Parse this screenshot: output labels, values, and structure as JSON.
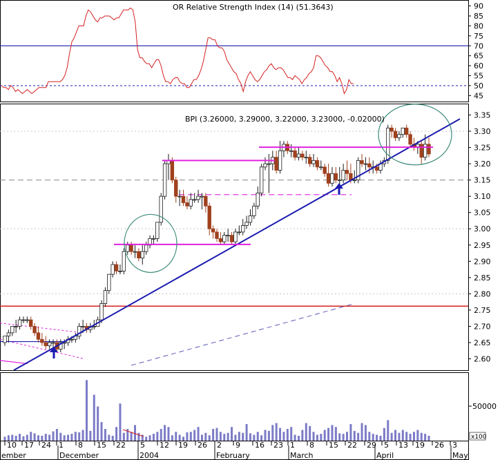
{
  "rsi": {
    "title": "OR Relative Strength Index (14) (51.3643)",
    "ticks": [
      90,
      85,
      80,
      75,
      70,
      65,
      60,
      55,
      50,
      45
    ],
    "ylim": [
      42,
      93
    ],
    "upper_level": 70,
    "lower_level": 50
  },
  "price": {
    "title": "BPI (3.26000, 3.29000, 3.22000, 3.23000, -0.02000)",
    "ticks": [
      "3.35",
      "3.30",
      "3.25",
      "3.20",
      "3.15",
      "3.10",
      "3.05",
      "3.00",
      "2.95",
      "2.90",
      "2.85",
      "2.80",
      "2.75",
      "2.70",
      "2.65",
      "2.60"
    ],
    "ylim": [
      2.565,
      3.385
    ]
  },
  "volume": {
    "tick_label": "50000",
    "scale_label": "x100"
  },
  "x_axis": {
    "day_labels": [
      "10",
      "17",
      "24",
      "1",
      "8",
      "15",
      "22",
      "5",
      "12",
      "19",
      "26",
      "2",
      "9",
      "16",
      "23",
      "1",
      "8",
      "15",
      "22",
      "29",
      "5",
      "13",
      "19",
      "26",
      "3"
    ],
    "month_labels": [
      "ember",
      "December",
      "2004",
      "February",
      "March",
      "April",
      "May"
    ]
  },
  "colors": {
    "background": "#ffffff",
    "grid": "#b0b0b0",
    "up_candle": "#ffffff",
    "down_candle": "#a0411e",
    "rsi_line": "#d42020",
    "trendline": "#1a1ab0",
    "resistance": "#e020e0",
    "support_red": "#d42020",
    "volume": "#7b7bc7",
    "circle": "#3d8a7a"
  },
  "chart_data": {
    "type": "candlestick",
    "dates": [
      "2003-11-06",
      "2003-11-07",
      "2003-11-10",
      "2003-11-11",
      "2003-11-12",
      "2003-11-13",
      "2003-11-14",
      "2003-11-17",
      "2003-11-18",
      "2003-11-19",
      "2003-11-20",
      "2003-11-21",
      "2003-11-24",
      "2003-11-25",
      "2003-11-26",
      "2003-11-27",
      "2003-11-28",
      "2003-12-01",
      "2003-12-02",
      "2003-12-03",
      "2003-12-04",
      "2003-12-05",
      "2003-12-08",
      "2003-12-09",
      "2003-12-10",
      "2003-12-11",
      "2003-12-12",
      "2003-12-15",
      "2003-12-16",
      "2003-12-17",
      "2003-12-18",
      "2003-12-19",
      "2003-12-22",
      "2003-12-23",
      "2003-12-26",
      "2003-12-29",
      "2003-12-30",
      "2004-01-02",
      "2004-01-05",
      "2004-01-06",
      "2004-01-07",
      "2004-01-08",
      "2004-01-09",
      "2004-01-12",
      "2004-01-13",
      "2004-01-14",
      "2004-01-15",
      "2004-01-16",
      "2004-01-19",
      "2004-01-20",
      "2004-01-21",
      "2004-01-22",
      "2004-01-23",
      "2004-01-26",
      "2004-01-27",
      "2004-01-28",
      "2004-01-29",
      "2004-01-30",
      "2004-02-02",
      "2004-02-03",
      "2004-02-04",
      "2004-02-05",
      "2004-02-06",
      "2004-02-09",
      "2004-02-10",
      "2004-02-11",
      "2004-02-12",
      "2004-02-13",
      "2004-02-16",
      "2004-02-17",
      "2004-02-18",
      "2004-02-19",
      "2004-02-20",
      "2004-02-23",
      "2004-02-24",
      "2004-02-26",
      "2004-02-27",
      "2004-03-01",
      "2004-03-02",
      "2004-03-03",
      "2004-03-04",
      "2004-03-05",
      "2004-03-08",
      "2004-03-09",
      "2004-03-10",
      "2004-03-11",
      "2004-03-12",
      "2004-03-15",
      "2004-03-16",
      "2004-03-17",
      "2004-03-18",
      "2004-03-19",
      "2004-03-22",
      "2004-03-23",
      "2004-03-24",
      "2004-03-25",
      "2004-03-26",
      "2004-03-29",
      "2004-03-30",
      "2004-03-31",
      "2004-04-01",
      "2004-04-02",
      "2004-04-05",
      "2004-04-06",
      "2004-04-07",
      "2004-04-12",
      "2004-04-13",
      "2004-04-14",
      "2004-04-15",
      "2004-04-16",
      "2004-04-19",
      "2004-04-20",
      "2004-04-21",
      "2004-04-22",
      "2004-04-23"
    ],
    "open": [
      2.65,
      2.67,
      2.68,
      2.7,
      2.7,
      2.72,
      2.72,
      2.72,
      2.7,
      2.68,
      2.66,
      2.65,
      2.64,
      2.65,
      2.65,
      2.63,
      2.65,
      2.65,
      2.66,
      2.66,
      2.67,
      2.7,
      2.7,
      2.69,
      2.7,
      2.7,
      2.72,
      2.77,
      2.81,
      2.86,
      2.89,
      2.87,
      2.87,
      2.93,
      2.95,
      2.93,
      2.93,
      2.91,
      2.93,
      2.95,
      2.97,
      2.97,
      3.02,
      3.1,
      3.2,
      3.21,
      3.15,
      3.1,
      3.1,
      3.08,
      3.07,
      3.09,
      3.09,
      3.1,
      3.1,
      3.07,
      3.0,
      2.99,
      2.97,
      2.96,
      2.98,
      2.98,
      2.96,
      2.99,
      2.99,
      3.01,
      3.02,
      3.04,
      3.07,
      3.11,
      3.19,
      3.2,
      3.2,
      3.22,
      3.18,
      3.24,
      3.26,
      3.24,
      3.24,
      3.22,
      3.23,
      3.22,
      3.22,
      3.2,
      3.21,
      3.19,
      3.19,
      3.17,
      3.14,
      3.17,
      3.15,
      3.15,
      3.18,
      3.17,
      3.15,
      3.15,
      3.21,
      3.2,
      3.2,
      3.19,
      3.19,
      3.18,
      3.2,
      3.21,
      3.31,
      3.3,
      3.28,
      3.29,
      3.31,
      3.29,
      3.26,
      3.25,
      3.26,
      3.22,
      3.26
    ],
    "high": [
      2.67,
      2.69,
      2.7,
      2.72,
      2.73,
      2.73,
      2.73,
      2.73,
      2.71,
      2.7,
      2.68,
      2.67,
      2.66,
      2.66,
      2.66,
      2.66,
      2.66,
      2.67,
      2.67,
      2.68,
      2.71,
      2.72,
      2.71,
      2.71,
      2.72,
      2.73,
      2.78,
      2.82,
      2.86,
      2.9,
      2.9,
      2.89,
      2.94,
      2.96,
      2.96,
      2.95,
      2.94,
      2.95,
      2.96,
      2.98,
      2.98,
      3.02,
      3.11,
      3.21,
      3.23,
      3.22,
      3.16,
      3.12,
      3.12,
      3.1,
      3.11,
      3.11,
      3.12,
      3.11,
      3.11,
      3.08,
      3.01,
      3.0,
      2.99,
      2.99,
      3.0,
      2.99,
      3.0,
      3.01,
      3.03,
      3.04,
      3.06,
      3.08,
      3.13,
      3.2,
      3.22,
      3.23,
      3.24,
      3.24,
      3.27,
      3.27,
      3.27,
      3.26,
      3.25,
      3.25,
      3.24,
      3.24,
      3.23,
      3.23,
      3.22,
      3.21,
      3.2,
      3.2,
      3.19,
      3.19,
      3.19,
      3.2,
      3.21,
      3.2,
      3.18,
      3.22,
      3.23,
      3.22,
      3.22,
      3.21,
      3.2,
      3.21,
      3.22,
      3.32,
      3.32,
      3.31,
      3.3,
      3.31,
      3.32,
      3.3,
      3.28,
      3.27,
      3.27,
      3.29,
      3.28
    ],
    "low": [
      2.64,
      2.65,
      2.67,
      2.68,
      2.69,
      2.71,
      2.71,
      2.69,
      2.67,
      2.65,
      2.64,
      2.63,
      2.63,
      2.63,
      2.62,
      2.62,
      2.63,
      2.64,
      2.65,
      2.65,
      2.66,
      2.68,
      2.68,
      2.68,
      2.69,
      2.7,
      2.71,
      2.76,
      2.8,
      2.85,
      2.86,
      2.86,
      2.86,
      2.92,
      2.92,
      2.91,
      2.9,
      2.89,
      2.92,
      2.94,
      2.95,
      2.96,
      3.01,
      3.09,
      3.15,
      3.14,
      3.08,
      3.07,
      3.07,
      3.06,
      3.06,
      3.08,
      3.08,
      3.06,
      3.05,
      2.98,
      2.97,
      2.96,
      2.95,
      2.95,
      2.96,
      2.95,
      2.95,
      2.98,
      2.98,
      3.0,
      3.01,
      3.03,
      3.06,
      3.1,
      3.18,
      3.11,
      3.18,
      3.17,
      3.17,
      3.22,
      3.23,
      3.22,
      3.21,
      3.21,
      3.21,
      3.2,
      3.19,
      3.19,
      3.18,
      3.18,
      3.16,
      3.13,
      3.13,
      3.14,
      3.13,
      3.14,
      3.15,
      3.14,
      3.14,
      3.14,
      3.19,
      3.18,
      3.17,
      3.17,
      3.17,
      3.17,
      3.19,
      3.2,
      3.28,
      3.27,
      3.27,
      3.28,
      3.28,
      3.25,
      3.24,
      3.23,
      3.2,
      3.21,
      3.22
    ],
    "close": [
      2.67,
      2.68,
      2.7,
      2.7,
      2.72,
      2.72,
      2.72,
      2.7,
      2.68,
      2.66,
      2.65,
      2.64,
      2.65,
      2.65,
      2.63,
      2.65,
      2.65,
      2.66,
      2.66,
      2.67,
      2.7,
      2.7,
      2.69,
      2.7,
      2.7,
      2.72,
      2.77,
      2.81,
      2.86,
      2.89,
      2.87,
      2.87,
      2.93,
      2.95,
      2.93,
      2.93,
      2.91,
      2.93,
      2.95,
      2.97,
      2.97,
      3.02,
      3.1,
      3.2,
      3.21,
      3.15,
      3.1,
      3.1,
      3.08,
      3.07,
      3.09,
      3.09,
      3.1,
      3.1,
      3.07,
      3.0,
      2.99,
      2.97,
      2.96,
      2.98,
      2.98,
      2.96,
      2.99,
      2.99,
      3.01,
      3.02,
      3.04,
      3.07,
      3.11,
      3.19,
      3.2,
      3.2,
      3.22,
      3.18,
      3.24,
      3.26,
      3.24,
      3.24,
      3.22,
      3.23,
      3.22,
      3.22,
      3.2,
      3.21,
      3.19,
      3.19,
      3.17,
      3.14,
      3.17,
      3.15,
      3.15,
      3.18,
      3.17,
      3.15,
      3.15,
      3.21,
      3.2,
      3.2,
      3.19,
      3.19,
      3.18,
      3.2,
      3.21,
      3.31,
      3.3,
      3.28,
      3.29,
      3.31,
      3.29,
      3.26,
      3.25,
      3.26,
      3.22,
      3.26,
      3.23
    ],
    "volume": [
      40,
      55,
      60,
      50,
      70,
      45,
      60,
      90,
      75,
      55,
      50,
      70,
      60,
      95,
      120,
      80,
      55,
      60,
      70,
      90,
      85,
      110,
      620,
      100,
      470,
      350,
      190,
      120,
      60,
      50,
      140,
      380,
      80,
      120,
      90,
      160,
      80,
      60,
      40,
      55,
      70,
      90,
      120,
      160,
      140,
      55,
      90,
      60,
      40,
      85,
      90,
      110,
      140,
      60,
      80,
      55,
      120,
      130,
      90,
      70,
      80,
      140,
      60,
      90,
      80,
      170,
      75,
      60,
      90,
      55,
      110,
      100,
      160,
      180,
      130,
      90,
      120,
      140,
      60,
      50,
      110,
      180,
      150,
      90,
      60,
      70,
      110,
      130,
      160,
      140,
      75,
      70,
      90,
      170,
      100,
      80,
      180,
      160,
      90,
      70,
      60,
      50,
      130,
      210,
      80,
      110,
      80,
      110,
      90,
      70,
      90,
      110,
      80,
      70,
      50
    ],
    "rsi": [
      50,
      49,
      49,
      48,
      50,
      49,
      47,
      48,
      47,
      46,
      47,
      48,
      47,
      46,
      47,
      48,
      49,
      49,
      49,
      49,
      52,
      52,
      52,
      52,
      52,
      52,
      53,
      55,
      59,
      66,
      72,
      74,
      77,
      80,
      80,
      80,
      85,
      88,
      87,
      85,
      83,
      82,
      84,
      84,
      85,
      85,
      85,
      84,
      83,
      84,
      84,
      86,
      88,
      88,
      88,
      89,
      88,
      82,
      68,
      64,
      64,
      62,
      61,
      61,
      59,
      61,
      63,
      63,
      60,
      55,
      52,
      52,
      51,
      53,
      54,
      54,
      52,
      51,
      51,
      49,
      49,
      51,
      53,
      53,
      55,
      58,
      62,
      68,
      74,
      74,
      73,
      73,
      70,
      69,
      69,
      67,
      63,
      61,
      59,
      57,
      56,
      53,
      51,
      47,
      52,
      55,
      57,
      55,
      53,
      52,
      53,
      55,
      57,
      58,
      60,
      61,
      59,
      58,
      59,
      59,
      58,
      56,
      54,
      54,
      53,
      55,
      54,
      53,
      51,
      53,
      54,
      56,
      57,
      59,
      65,
      65,
      64,
      62,
      60,
      59,
      57,
      57,
      55,
      52,
      54,
      51,
      46,
      48,
      53,
      51,
      51
    ],
    "annotations": {
      "trendline": [
        [
          "2003-11-15",
          2.58
        ],
        [
          "2004-04-30",
          3.34
        ]
      ],
      "resistance_1": [
        [
          "2003-12-29",
          2.955
        ],
        [
          "2004-01-06",
          2.955
        ]
      ],
      "resistance_1b": [
        [
          "2004-01-06",
          2.955
        ],
        [
          "2004-02-11",
          2.955
        ]
      ],
      "resistance_2": [
        [
          "2004-01-13",
          3.21
        ],
        [
          "2004-02-20",
          3.21
        ]
      ],
      "resistance_3": [
        [
          "2004-02-20",
          3.25
        ],
        [
          "2004-04-18",
          3.25
        ]
      ],
      "dashed_support_1": [
        [
          "2004-01-13",
          3.105
        ],
        [
          "2004-03-20",
          3.105
        ]
      ],
      "dashed_support_2": [
        [
          "2004-02-20",
          3.15
        ],
        [
          "2004-04-30",
          3.15
        ]
      ],
      "red_support": 2.762,
      "arrows": [
        [
          "2003-11-26",
          2.62
        ],
        [
          "2004-03-17",
          3.09
        ]
      ],
      "circles": [
        [
          "2004-01-08",
          2.95
        ],
        [
          "2004-04-14",
          3.25
        ]
      ]
    }
  }
}
